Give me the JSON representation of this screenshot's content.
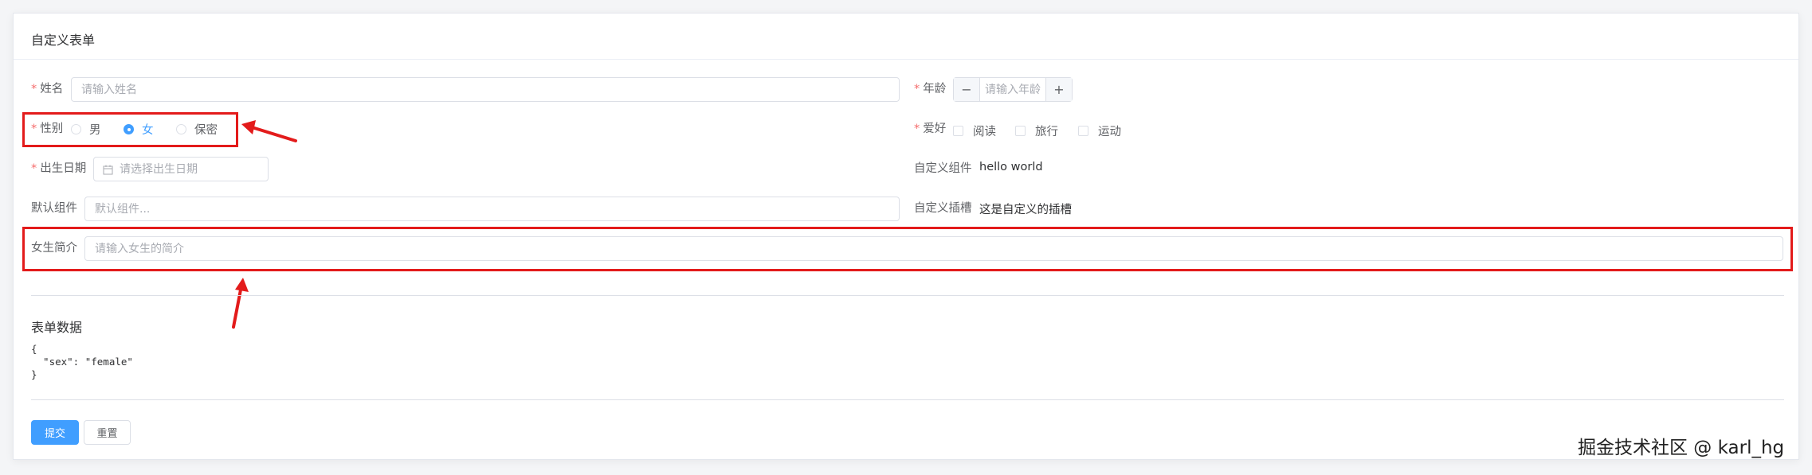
{
  "card": {
    "title": "自定义表单"
  },
  "form": {
    "name": {
      "label": "姓名",
      "placeholder": "请输入姓名"
    },
    "age": {
      "label": "年龄",
      "placeholder": "请输入年龄",
      "minus": "−",
      "plus": "+"
    },
    "gender": {
      "label": "性别",
      "options": [
        {
          "label": "男",
          "checked": false
        },
        {
          "label": "女",
          "checked": true
        },
        {
          "label": "保密",
          "checked": false
        }
      ]
    },
    "hobby": {
      "label": "爱好",
      "options": [
        {
          "label": "阅读",
          "checked": false
        },
        {
          "label": "旅行",
          "checked": false
        },
        {
          "label": "运动",
          "checked": false
        }
      ]
    },
    "birthday": {
      "label": "出生日期",
      "placeholder": "请选择出生日期",
      "icon": "calendar-icon"
    },
    "custom_component": {
      "label": "自定义组件",
      "value": "hello world"
    },
    "default_component": {
      "label": "默认组件",
      "placeholder": "默认组件..."
    },
    "custom_slot": {
      "label": "自定义插槽",
      "value": "这是自定义的插槽"
    },
    "intro": {
      "label": "女生简介",
      "placeholder": "请输入女生的简介"
    }
  },
  "form_data": {
    "title": "表单数据",
    "json_text": "{\n  \"sex\": \"female\"\n}"
  },
  "actions": {
    "submit": "提交",
    "reset": "重置"
  },
  "watermark": "掘金技术社区 @ karl_hg",
  "colors": {
    "primary": "#409eff",
    "required": "#f56c6c",
    "annotation": "#e31b1b"
  }
}
